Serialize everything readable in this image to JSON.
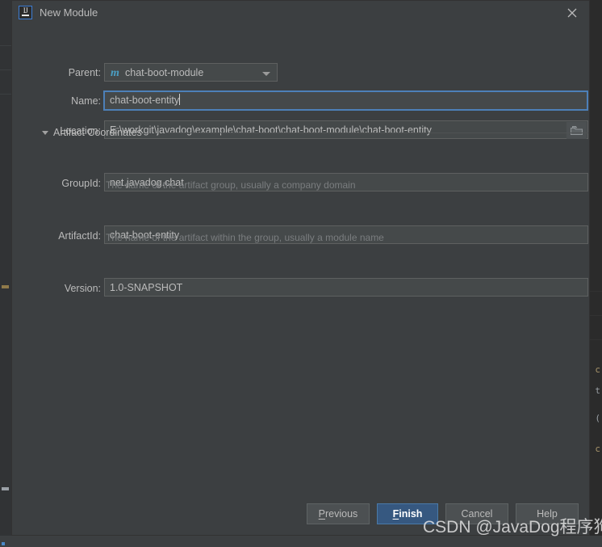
{
  "window": {
    "title": "New Module",
    "app_icon": "intellij-idea-icon",
    "close_icon": "close-icon"
  },
  "form": {
    "parent": {
      "label": "Parent:",
      "value": "chat-boot-module",
      "module_icon": "maven-module-icon",
      "dropdown_icon": "chevron-down-icon"
    },
    "name": {
      "label": "Name:",
      "value": "chat-boot-entity"
    },
    "location": {
      "label": "Location:",
      "value": "E:\\workgit\\javadog\\example\\chat-boot\\chat-boot-module\\chat-boot-entity",
      "browse_icon": "folder-icon"
    },
    "artifact_section": {
      "label": "Artifact Coordinates",
      "expanded": true,
      "toggle_icon": "triangle-down-icon"
    },
    "group_id": {
      "label": "GroupId:",
      "value": "net.javadog.chat",
      "hint": "The name of the artifact group, usually a company domain"
    },
    "artifact_id": {
      "label": "ArtifactId:",
      "value": "chat-boot-entity",
      "hint": "The name of the artifact within the group, usually a module name"
    },
    "version": {
      "label": "Version:",
      "value": "1.0-SNAPSHOT"
    }
  },
  "buttons": {
    "previous": {
      "label": "Previous",
      "mnemonic": "P"
    },
    "finish": {
      "label": "Finish",
      "mnemonic": "F",
      "primary": true
    },
    "cancel": {
      "label": "Cancel"
    },
    "help": {
      "label": "Help"
    }
  },
  "watermark": {
    "text": "CSDN @JavaDog程序狗"
  },
  "background": {
    "code_fragments": [
      "c",
      "t",
      "(",
      "c"
    ]
  },
  "colors": {
    "dialog_bg": "#3c3f41",
    "field_bg": "#45494a",
    "text": "#bbbbbb",
    "hint_text": "#7a7d7f",
    "accent_blue": "#4d80b8",
    "primary_button": "#365880",
    "maven_icon": "#4a9fc4"
  }
}
